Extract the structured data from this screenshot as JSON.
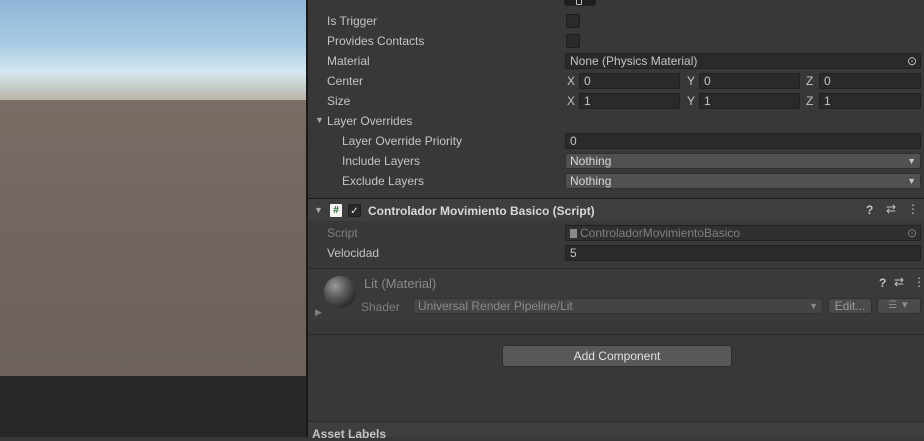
{
  "collider": {
    "is_trigger": {
      "label": "Is Trigger",
      "checked": false
    },
    "provides_contacts": {
      "label": "Provides Contacts",
      "checked": false
    },
    "material": {
      "label": "Material",
      "value": "None (Physics Material)"
    },
    "center": {
      "label": "Center",
      "x": "0",
      "y": "0",
      "z": "0"
    },
    "size": {
      "label": "Size",
      "x": "1",
      "y": "1",
      "z": "1"
    },
    "axes": {
      "x": "X",
      "y": "Y",
      "z": "Z"
    },
    "layer_overrides": {
      "label": "Layer Overrides",
      "priority_label": "Layer Override Priority",
      "priority_value": "0",
      "include_label": "Include Layers",
      "include_value": "Nothing",
      "exclude_label": "Exclude Layers",
      "exclude_value": "Nothing"
    }
  },
  "script_component": {
    "title": "Controlador Movimiento Basico (Script)",
    "enabled": true,
    "script_label": "Script",
    "script_value": "ControladorMovimientoBasico",
    "velocidad_label": "Velocidad",
    "velocidad_value": "5"
  },
  "material": {
    "title": "Lit (Material)",
    "shader_label": "Shader",
    "shader_value": "Universal Render Pipeline/Lit",
    "edit_label": "Edit..."
  },
  "add_component_label": "Add Component",
  "asset_labels": "Asset Labels",
  "icons": {
    "help": "?",
    "presets": "⇄",
    "menu": "⋮",
    "check": "✓",
    "hash": "#",
    "caret": "▼",
    "foldout_open": "▼",
    "foldout_closed": "▶",
    "target": "⊙",
    "list": "☰"
  }
}
